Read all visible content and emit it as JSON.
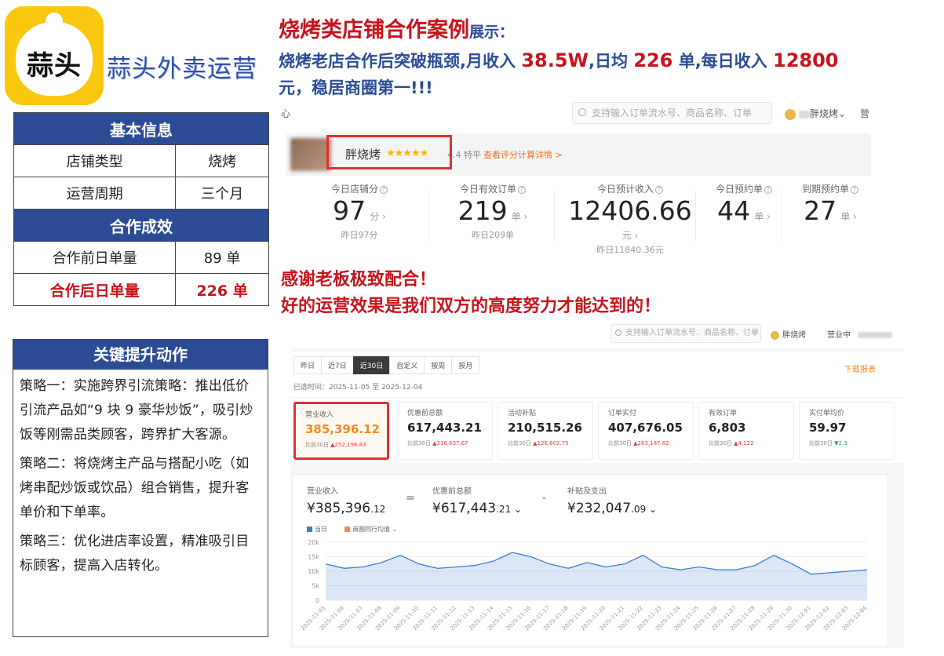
{
  "logo": {
    "text": "蒜头"
  },
  "brand": {
    "name": "蒜头外卖运营"
  },
  "headline": {
    "title_red": "烧烤类店铺合作案例",
    "title_blue": "展示：",
    "line_a": "烧烤老店合作后突破瓶颈,月收入 ",
    "monthly": "38.5W",
    "line_b": ",日均 ",
    "daily": "226",
    "line_c": " 单,每日收入 ",
    "income": "12800",
    "line_d": "元，稳居商圈第一!!!"
  },
  "basic_info": {
    "header": "基本信息",
    "rows": [
      {
        "label": "店铺类型",
        "value": "烧烤"
      },
      {
        "label": "运营周期",
        "value": "三个月"
      }
    ],
    "effect_header": "合作成效",
    "before": {
      "label": "合作前日单量",
      "value": "89 单"
    },
    "after": {
      "label": "合作后日单量",
      "value": "226 单"
    }
  },
  "actions": {
    "header": "关键提升动作",
    "strategies": [
      "策略一：实施跨界引流策略：推出低价引流产品如“9 块 9 豪华炒饭”，吸引炒饭等刚需品类顾客，跨界扩大客源。",
      "策略二：将烧烤主产品与搭配小吃（如烤串配炒饭或饮品）组合销售，提升客单价和下单率。",
      "策略三：优化进店率设置，精准吸引目标顾客，提高入店转化。"
    ]
  },
  "thanks": {
    "line1": "感谢老板极致配合！",
    "line2": "好的运营效果是我们双方的高度努力才能达到的！"
  },
  "shot1": {
    "corner": "心",
    "search_placeholder": "支持输入订单流水号、商品名称、订单",
    "user": "胖烧烤",
    "user_caret": "⌄",
    "right": "营",
    "store_name": "胖烧烤",
    "stars": "★★★★★",
    "rating": "4.4 特平",
    "rating_link": "查看评分计算详情 >",
    "metrics": [
      {
        "label": "今日店铺分",
        "value": "97",
        "unit": "分 ›",
        "yesterday": "昨日97分"
      },
      {
        "label": "今日有效订单",
        "value": "219",
        "unit": "单 ›",
        "yesterday": "昨日209单"
      },
      {
        "label": "今日预计收入",
        "value": "12406.66",
        "unit": "元 ›",
        "yesterday": "昨日11840.36元"
      },
      {
        "label": "今日预约单",
        "value": "44",
        "unit": "单 ›",
        "yesterday": ""
      },
      {
        "label": "到期预约单",
        "value": "27",
        "unit": "单 ›",
        "yesterday": ""
      }
    ]
  },
  "shot2": {
    "search_placeholder": "支持输入订单流水号、商品名称、订单",
    "user": "胖烧烤",
    "status": "营业中",
    "tabs": [
      "昨日",
      "近7日",
      "近30日",
      "自定义",
      "按周",
      "按月"
    ],
    "active_tab": 2,
    "download": "下载报表",
    "range": "已选时间：2025-11-05 至 2025-12-04",
    "cards": [
      {
        "label": "营业收入",
        "value": "385,396.12",
        "cmp": "比前30日",
        "delta": "▲252,196.83",
        "dir": "up"
      },
      {
        "label": "优惠前总额",
        "value": "617,443.21",
        "cmp": "比前30日",
        "delta": "▲316,657.67",
        "dir": "up"
      },
      {
        "label": "活动补贴",
        "value": "210,515.26",
        "cmp": "比前30日",
        "delta": "▲126,602.75",
        "dir": "up"
      },
      {
        "label": "订单实付",
        "value": "407,676.05",
        "cmp": "比前30日",
        "delta": "▲283,187.82",
        "dir": "up"
      },
      {
        "label": "有效订单",
        "value": "6,803",
        "cmp": "比前30日",
        "delta": "▲4,122",
        "dir": "up"
      },
      {
        "label": "实付单均价",
        "value": "59.97",
        "cmp": "比前30日",
        "delta": "▼2.3",
        "dir": "down"
      }
    ],
    "summary": [
      {
        "label": "营业收入",
        "currency": "¥",
        "value": "385,396",
        "decimals": ".12"
      },
      {
        "label": "优惠前总额",
        "currency": "¥",
        "value": "617,443",
        "decimals": ".21 ⌄"
      },
      {
        "label": "补贴及支出",
        "currency": "¥",
        "value": "232,047",
        "decimals": ".09 ⌄"
      }
    ],
    "ops": [
      "=",
      "-"
    ],
    "legend_current": "当日",
    "legend_avg": "商圈同行均值 ⌄",
    "colors": {
      "current": "#3a7bd5",
      "avg": "#f08a50"
    }
  },
  "chart_data": {
    "type": "area",
    "x": [
      "2025-11-05",
      "2025-11-06",
      "2025-11-07",
      "2025-11-08",
      "2025-11-09",
      "2025-11-10",
      "2025-11-11",
      "2025-11-12",
      "2025-11-13",
      "2025-11-14",
      "2025-11-15",
      "2025-11-16",
      "2025-11-17",
      "2025-11-18",
      "2025-11-19",
      "2025-11-20",
      "2025-11-21",
      "2025-11-22",
      "2025-11-23",
      "2025-11-24",
      "2025-11-25",
      "2025-11-26",
      "2025-11-27",
      "2025-11-28",
      "2025-11-29",
      "2025-11-30",
      "2025-12-01",
      "2025-12-02",
      "2025-12-03",
      "2025-12-04"
    ],
    "series": [
      {
        "name": "当日",
        "values": [
          12500,
          11000,
          11500,
          13000,
          15500,
          12500,
          11000,
          11500,
          12000,
          13500,
          16500,
          15000,
          12500,
          11000,
          13000,
          11500,
          12500,
          15500,
          11500,
          10500,
          11500,
          10500,
          10500,
          12000,
          15500,
          12500,
          9000,
          9500,
          10000,
          10500
        ]
      }
    ],
    "y_ticks": [
      "20k",
      "15k",
      "10k",
      "5k",
      "0"
    ],
    "ylim": [
      0,
      20000
    ],
    "grid": true
  }
}
